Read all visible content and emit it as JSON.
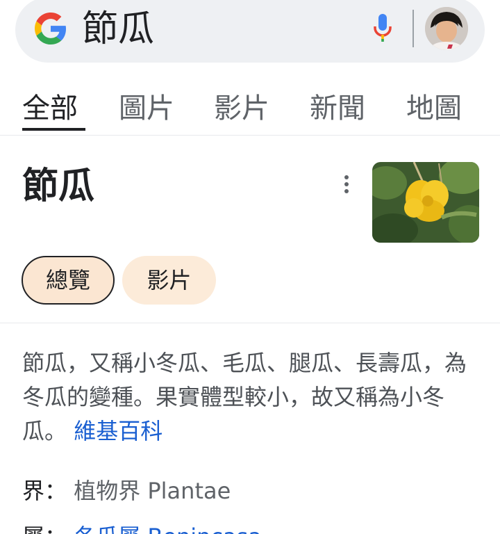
{
  "search": {
    "query": "節瓜"
  },
  "tabs": [
    "全部",
    "圖片",
    "影片",
    "新聞",
    "地圖"
  ],
  "knowledge_panel": {
    "title": "節瓜",
    "chips": [
      "總覽",
      "影片"
    ],
    "description": "節瓜，又稱小冬瓜、毛瓜、腿瓜、長壽瓜，為冬瓜的變種。果實體型較小，故又稱為小冬瓜。",
    "source_link": "維基百科",
    "facts": [
      {
        "label": "界：",
        "value": "植物界 Plantae"
      },
      {
        "label": "屬：",
        "value": "冬瓜屬 Benincasa"
      }
    ]
  },
  "colors": {
    "accent_link": "#1a5fd1",
    "chip_bg": "#fcebd9",
    "search_bg": "#eef0f3"
  }
}
